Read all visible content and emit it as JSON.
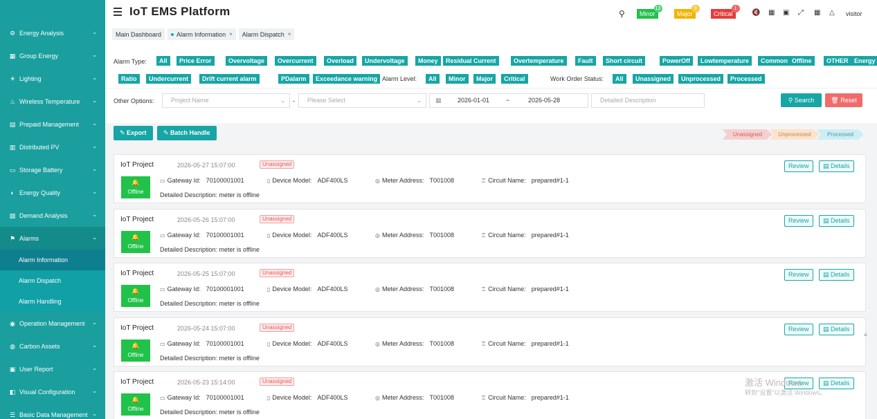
{
  "app": {
    "title": "IoT EMS Platform",
    "user": "visitor"
  },
  "header": {
    "levels": [
      {
        "label": "Minor",
        "count": "13",
        "color": "#22c04a",
        "count_color": "#4cd47a"
      },
      {
        "label": "Major",
        "count": "0",
        "color": "#f0b400",
        "count_color": "#f7c845"
      },
      {
        "label": "Critical",
        "count": "1",
        "color": "#e53b3b",
        "count_color": "#ef6666"
      }
    ],
    "icons": [
      "search-icon",
      "mute-icon",
      "grid-icon",
      "screen-icon",
      "fullscreen-icon",
      "translate-icon",
      "shirt-icon"
    ]
  },
  "sidebar": {
    "items": [
      {
        "label": "Energy Analysis",
        "icon": "gear-icon"
      },
      {
        "label": "Group Energy",
        "icon": "grid-icon"
      },
      {
        "label": "Lighting",
        "icon": "bulb-icon"
      },
      {
        "label": "Wireless Temperature",
        "icon": "thermometer-icon"
      },
      {
        "label": "Prepaid Management",
        "icon": "prepaid-icon"
      },
      {
        "label": "Distributed PV",
        "icon": "solar-icon"
      },
      {
        "label": "Storage Battery",
        "icon": "battery-icon"
      },
      {
        "label": "Energy Quality",
        "icon": "quality-icon"
      },
      {
        "label": "Demand Analysis",
        "icon": "demand-icon"
      },
      {
        "label": "Alarms",
        "icon": "alarm-icon"
      }
    ],
    "alarm_subitems": [
      "Alarm Information",
      "Alarm Dispatch",
      "Alarm Handling"
    ],
    "items_after": [
      {
        "label": "Operation Management",
        "icon": "operation-icon"
      },
      {
        "label": "Carbon Assets",
        "icon": "carbon-icon"
      },
      {
        "label": "User Report",
        "icon": "report-icon"
      },
      {
        "label": "Visual Configuration",
        "icon": "visual-icon"
      },
      {
        "label": "Basic Data Management",
        "icon": "data-icon"
      }
    ]
  },
  "tabs": [
    "Main Dashboard",
    "Alarm Information",
    "Alarm Dispatch"
  ],
  "filters": {
    "alarm_type_label": "Alarm Type:",
    "alarm_types_row1": [
      "All",
      "Price Error",
      "Overvoltage",
      "Overcurrent",
      "Overload",
      "Undervoltage",
      "Money",
      "Residual Current",
      "Overtemperature",
      "Fault",
      "Short circuit",
      "PowerOff",
      "Lowtemperature",
      "Common",
      "Offline",
      "OTHER",
      "Energy"
    ],
    "alarm_types_row2": [
      "Ratio",
      "Undercurrent",
      "Drift current alarm",
      "PDalarm",
      "Exceedance warning"
    ],
    "alarm_level_label": "Alarm Level:",
    "alarm_levels": [
      "All",
      "Minor",
      "Major",
      "Critical"
    ],
    "work_order_label": "Work Order Status:",
    "work_order_statuses": [
      "All",
      "Unassigned",
      "Unprocessed",
      "Processed"
    ],
    "other_options_label": "Other Options:",
    "project_placeholder": "Project Name",
    "separator": "-",
    "select_placeholder": "Please Select",
    "date_from": "2026-01-01",
    "date_sep": "~",
    "date_to": "2026-05-28",
    "desc_placeholder": "Detailed Description",
    "search_label": "Search",
    "reset_label": "Reset"
  },
  "toolbar": {
    "export_label": "Export",
    "batch_label": "Batch Handle",
    "legend": [
      {
        "label": "Unassigned",
        "color": "#f6d0d0",
        "text": "#d06060"
      },
      {
        "label": "Unprocessed",
        "color": "#fbe3cc",
        "text": "#c08850"
      },
      {
        "label": "Processed",
        "color": "#cdeef2",
        "text": "#4a9aa8"
      }
    ]
  },
  "alarms": [
    {
      "project": "IoT Project",
      "time": "2026-05-27 15:07:00",
      "status_badge": "Unassigned",
      "state": "Offline",
      "gateway_label": "Gateway Id:",
      "gateway": "70100001001",
      "model_label": "Device Model:",
      "model": "ADF400LS",
      "meter_label": "Meter Address:",
      "meter": "T001008",
      "circuit_label": "Circuit Name:",
      "circuit": "prepared#1-1",
      "desc": "Detailed Description: meter is offline",
      "review": "Review",
      "details": "Details"
    },
    {
      "project": "IoT Project",
      "time": "2026-05-26 15:07:00",
      "status_badge": "Unassigned",
      "state": "Offline",
      "gateway_label": "Gateway Id:",
      "gateway": "70100001001",
      "model_label": "Device Model:",
      "model": "ADF400LS",
      "meter_label": "Meter Address:",
      "meter": "T001008",
      "circuit_label": "Circuit Name:",
      "circuit": "prepared#1-1",
      "desc": "Detailed Description: meter is offline",
      "review": "Review",
      "details": "Details"
    },
    {
      "project": "IoT Project",
      "time": "2026-05-25 15:07:00",
      "status_badge": "Unassigned",
      "state": "Offline",
      "gateway_label": "Gateway Id:",
      "gateway": "70100001001",
      "model_label": "Device Model:",
      "model": "ADF400LS",
      "meter_label": "Meter Address:",
      "meter": "T001008",
      "circuit_label": "Circuit Name:",
      "circuit": "prepared#1-1",
      "desc": "Detailed Description: meter is offline",
      "review": "Review",
      "details": "Details"
    },
    {
      "project": "IoT Project",
      "time": "2026-05-24 15:07:00",
      "status_badge": "Unassigned",
      "state": "Offline",
      "gateway_label": "Gateway Id:",
      "gateway": "70100001001",
      "model_label": "Device Model:",
      "model": "ADF400LS",
      "meter_label": "Meter Address:",
      "meter": "T001008",
      "circuit_label": "Circuit Name:",
      "circuit": "prepared#1-1",
      "desc": "Detailed Description: meter is offline",
      "review": "Review",
      "details": "Details"
    },
    {
      "project": "IoT Project",
      "time": "2026-05-23 15:14:00",
      "status_badge": "Unassigned",
      "state": "Offline",
      "gateway_label": "Gateway Id:",
      "gateway": "70100001001",
      "model_label": "Device Model:",
      "model": "ADF400LS",
      "meter_label": "Meter Address:",
      "meter": "T001008",
      "circuit_label": "Circuit Name:",
      "circuit": "prepared#1-1",
      "desc": "Detailed Description: meter is offline",
      "review": "Review",
      "details": "Details"
    }
  ],
  "watermark": {
    "line1": "激活 Windows",
    "line2": "转到\"设置\"以激活 Windows。"
  }
}
